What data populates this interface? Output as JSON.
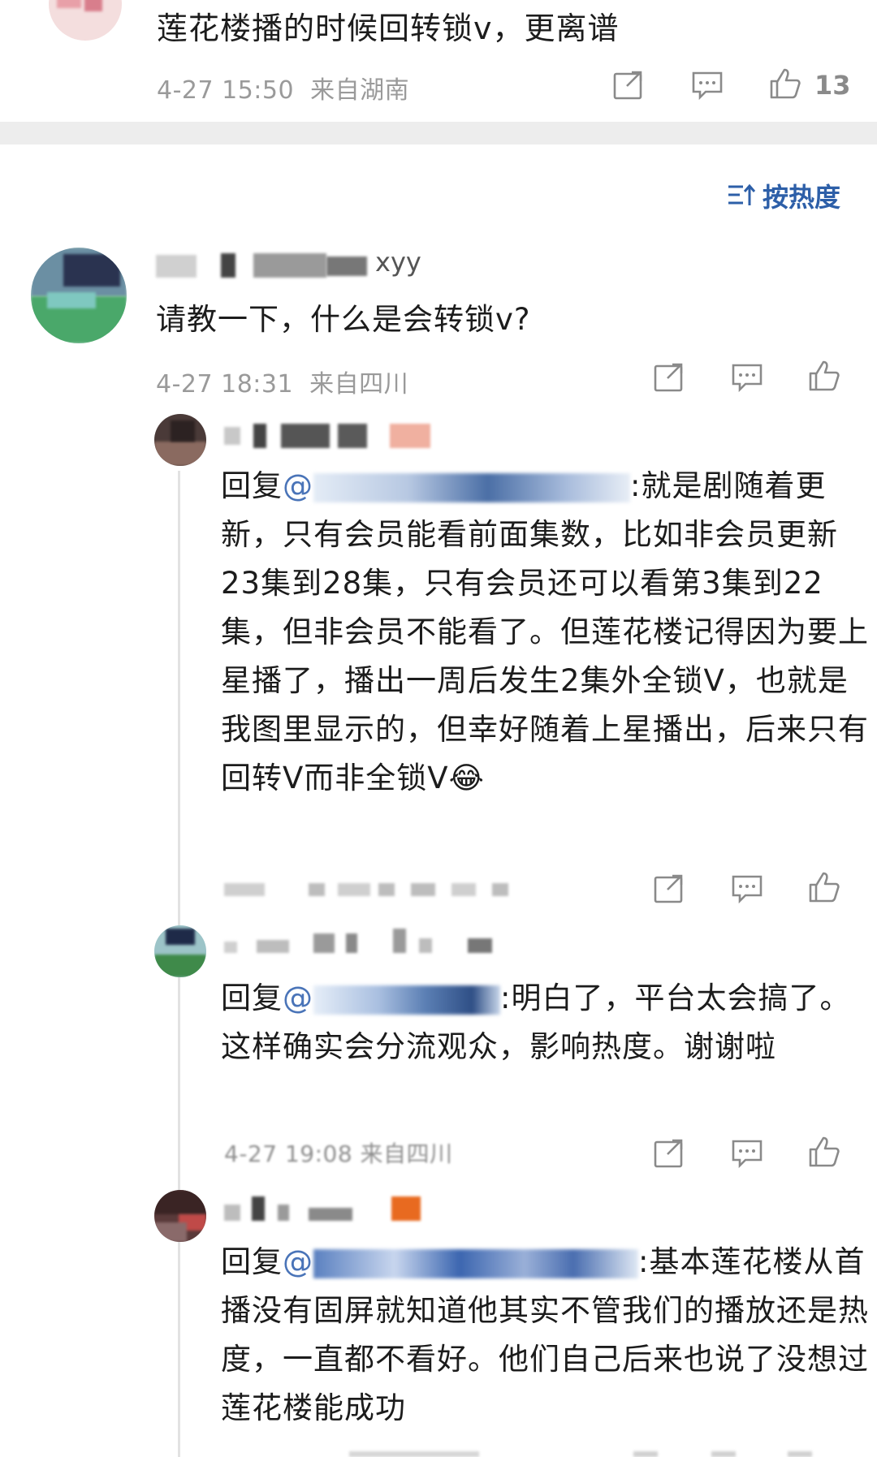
{
  "top_comment": {
    "text": "莲花楼播的时候回转锁v，更离谱",
    "time": "4-27 15:50",
    "location": "来自湖南",
    "likes": "13"
  },
  "sort": {
    "label": "按热度",
    "icon": "sort-icon"
  },
  "comment": {
    "username": "xyy",
    "text": "请教一下，什么是会转锁v?",
    "time": "4-27 18:31",
    "location": "来自四川"
  },
  "replies": [
    {
      "prefix": "回复",
      "mention": "@",
      "text": ":就是剧随着更新，只有会员能看前面集数，比如非会员更新23集到28集，只有会员还可以看第3集到22集，但非会员不能看了。但莲花楼记得因为要上星播了，播出一周后发生2集外全锁V，也就是我图里显示的，但幸好随着上星播出，后来只有回转V而非全锁V",
      "emoji": "😂"
    },
    {
      "prefix": "回复",
      "mention": "@",
      "text": ":明白了，平台太会搞了。这样确实会分流观众，影响热度。谢谢啦",
      "meta": "4-27 19:08 来自四川"
    },
    {
      "prefix": "回复",
      "mention": "@",
      "text": ":基本莲花楼从首播没有固屏就知道他其实不管我们的播放还是热度，一直都不看好。他们自己后来也说了没想过莲花楼能成功"
    }
  ],
  "icons": [
    "share-icon",
    "comment-icon",
    "like-icon"
  ],
  "colors": {
    "accent": "#2d5fa8",
    "meta": "#9a9a9a",
    "divider": "#ededed"
  }
}
